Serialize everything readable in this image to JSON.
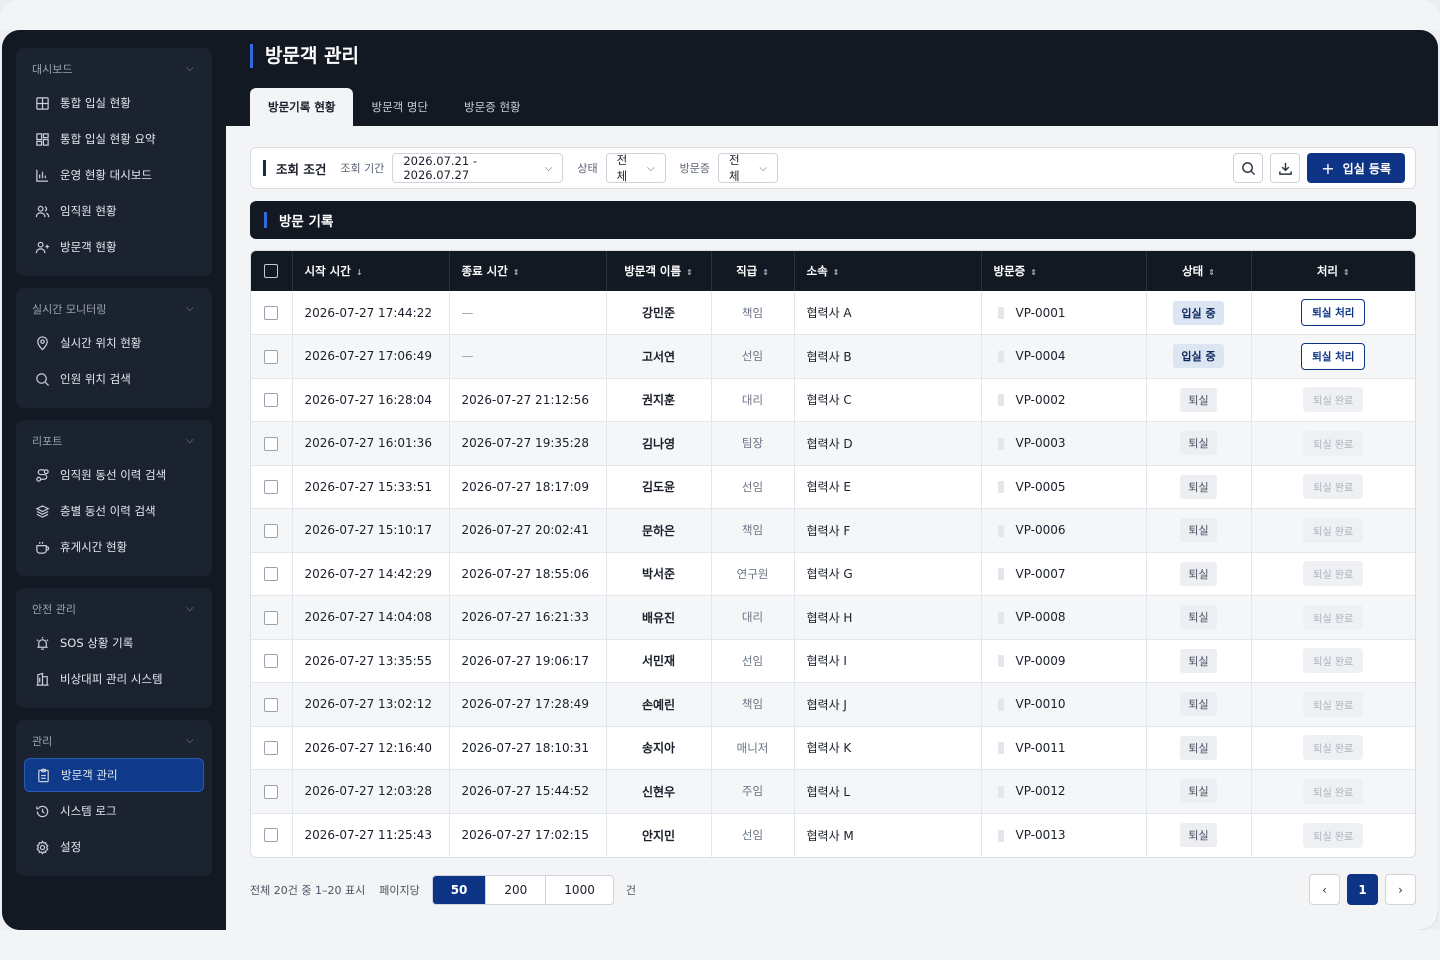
{
  "sidebar": {
    "groups": [
      {
        "title": "대시보드",
        "items": [
          {
            "label": "통합 입실 현황",
            "icon": "grid-icon"
          },
          {
            "label": "통합 입실 현황 요약",
            "icon": "dashboard-icon"
          },
          {
            "label": "운영 현황 대시보드",
            "icon": "bar-chart-icon"
          },
          {
            "label": "임직원 현황",
            "icon": "users-icon"
          },
          {
            "label": "방문객 현황",
            "icon": "user-plus-icon"
          }
        ]
      },
      {
        "title": "실시간 모니터링",
        "items": [
          {
            "label": "실시간 위치 현황",
            "icon": "map-pin-icon"
          },
          {
            "label": "인원 위치 검색",
            "icon": "search-icon"
          }
        ]
      },
      {
        "title": "리포트",
        "items": [
          {
            "label": "임직원 동선 이력 검색",
            "icon": "route-icon"
          },
          {
            "label": "층별 동선 이력 검색",
            "icon": "layers-icon"
          },
          {
            "label": "휴게시간 현황",
            "icon": "coffee-icon"
          }
        ]
      },
      {
        "title": "안전 관리",
        "items": [
          {
            "label": "SOS 상황 기록",
            "icon": "alarm-icon"
          },
          {
            "label": "비상대피 관리 시스템",
            "icon": "building-icon"
          }
        ]
      },
      {
        "title": "관리",
        "items": [
          {
            "label": "방문객 관리",
            "icon": "clipboard-icon",
            "active": true
          },
          {
            "label": "시스템 로그",
            "icon": "history-icon"
          },
          {
            "label": "설정",
            "icon": "gear-icon"
          }
        ]
      }
    ]
  },
  "header": {
    "title": "방문객 관리",
    "tabs": [
      "방문기록 현황",
      "방문객 명단",
      "방문증 현황"
    ]
  },
  "filter": {
    "title": "조회 조건",
    "period_label": "조회 기간",
    "period_value": "2026.07.21 - 2026.07.27",
    "status_label": "상태",
    "status_value": "전체",
    "pass_label": "방문증",
    "pass_value": "전체",
    "register_label": "입실 등록"
  },
  "section": {
    "title": "방문 기록"
  },
  "table": {
    "columns": [
      "시작 시간",
      "종료 시간",
      "방문객 이름",
      "직급",
      "소속",
      "방문증",
      "상태",
      "처리"
    ],
    "rows": [
      {
        "start": "2026-07-27 17:44:22",
        "end": "—",
        "name": "강민준",
        "rank": "책임",
        "org": "협력사 A",
        "pass": "VP-0001",
        "status": "입실 중",
        "action": "퇴실 처리"
      },
      {
        "start": "2026-07-27 17:06:49",
        "end": "—",
        "name": "고서연",
        "rank": "선임",
        "org": "협력사 B",
        "pass": "VP-0004",
        "status": "입실 중",
        "action": "퇴실 처리"
      },
      {
        "start": "2026-07-27 16:28:04",
        "end": "2026-07-27 21:12:56",
        "name": "권지훈",
        "rank": "대리",
        "org": "협력사 C",
        "pass": "VP-0002",
        "status": "퇴실",
        "action": "퇴실 완료"
      },
      {
        "start": "2026-07-27 16:01:36",
        "end": "2026-07-27 19:35:28",
        "name": "김나영",
        "rank": "팀장",
        "org": "협력사 D",
        "pass": "VP-0003",
        "status": "퇴실",
        "action": "퇴실 완료"
      },
      {
        "start": "2026-07-27 15:33:51",
        "end": "2026-07-27 18:17:09",
        "name": "김도윤",
        "rank": "선임",
        "org": "협력사 E",
        "pass": "VP-0005",
        "status": "퇴실",
        "action": "퇴실 완료"
      },
      {
        "start": "2026-07-27 15:10:17",
        "end": "2026-07-27 20:02:41",
        "name": "문하은",
        "rank": "책임",
        "org": "협력사 F",
        "pass": "VP-0006",
        "status": "퇴실",
        "action": "퇴실 완료"
      },
      {
        "start": "2026-07-27 14:42:29",
        "end": "2026-07-27 18:55:06",
        "name": "박서준",
        "rank": "연구원",
        "org": "협력사 G",
        "pass": "VP-0007",
        "status": "퇴실",
        "action": "퇴실 완료"
      },
      {
        "start": "2026-07-27 14:04:08",
        "end": "2026-07-27 16:21:33",
        "name": "배유진",
        "rank": "대리",
        "org": "협력사 H",
        "pass": "VP-0008",
        "status": "퇴실",
        "action": "퇴실 완료"
      },
      {
        "start": "2026-07-27 13:35:55",
        "end": "2026-07-27 19:06:17",
        "name": "서민재",
        "rank": "선임",
        "org": "협력사 I",
        "pass": "VP-0009",
        "status": "퇴실",
        "action": "퇴실 완료"
      },
      {
        "start": "2026-07-27 13:02:12",
        "end": "2026-07-27 17:28:49",
        "name": "손예린",
        "rank": "책임",
        "org": "협력사 J",
        "pass": "VP-0010",
        "status": "퇴실",
        "action": "퇴실 완료"
      },
      {
        "start": "2026-07-27 12:16:40",
        "end": "2026-07-27 18:10:31",
        "name": "송지아",
        "rank": "매니저",
        "org": "협력사 K",
        "pass": "VP-0011",
        "status": "퇴실",
        "action": "퇴실 완료"
      },
      {
        "start": "2026-07-27 12:03:28",
        "end": "2026-07-27 15:44:52",
        "name": "신현우",
        "rank": "주임",
        "org": "협력사 L",
        "pass": "VP-0012",
        "status": "퇴실",
        "action": "퇴실 완료"
      },
      {
        "start": "2026-07-27 11:25:43",
        "end": "2026-07-27 17:02:15",
        "name": "안지민",
        "rank": "선임",
        "org": "협력사 M",
        "pass": "VP-0013",
        "status": "퇴실",
        "action": "퇴실 완료"
      }
    ]
  },
  "pager": {
    "summary": "전체 20건 중 1–20 표시",
    "per_page_label": "페이지당",
    "sizes": [
      "50",
      "200",
      "1000"
    ],
    "active_size": "50",
    "unit": "건",
    "prev": "‹",
    "current_page": "1",
    "next": "›"
  },
  "colors": {
    "accent": "#0e3486",
    "sidebar_bg": "#131922",
    "active_nav": "#0f3a8a"
  }
}
